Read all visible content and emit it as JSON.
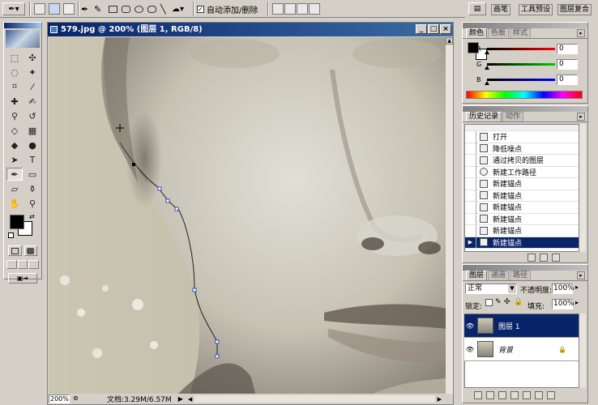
{
  "options_bar": {
    "auto_add_delete_label": "自动添加/删除",
    "auto_add_delete_checked": true
  },
  "panel_well": {
    "tabs": [
      "画笔",
      "工具预设",
      "图层复合"
    ]
  },
  "document": {
    "title": "579.jpg @ 200% (图层 1, RGB/8)",
    "zoom": "200%",
    "doc_size": "文档:3.29M/6.57M"
  },
  "color_panel": {
    "tabs": [
      "颜色",
      "色板",
      "样式"
    ],
    "active_tab": "颜色",
    "channels": [
      {
        "label": "R",
        "value": "0",
        "color": "#d00000"
      },
      {
        "label": "G",
        "value": "0",
        "color": "#00b000"
      },
      {
        "label": "B",
        "value": "0",
        "color": "#0000d0"
      }
    ],
    "foreground": "#000000",
    "background": "#ffffff"
  },
  "history_panel": {
    "tabs": [
      "历史记录",
      "动作"
    ],
    "active_tab": "历史记录",
    "items": [
      {
        "label": "打开"
      },
      {
        "label": "降低噪点"
      },
      {
        "label": "通过拷贝的图层"
      },
      {
        "label": "新建工作路径"
      },
      {
        "label": "新建锚点"
      },
      {
        "label": "新建锚点"
      },
      {
        "label": "新建锚点"
      },
      {
        "label": "新建锚点"
      },
      {
        "label": "新建锚点"
      },
      {
        "label": "新建锚点"
      }
    ],
    "selected_index": 9
  },
  "layers_panel": {
    "tabs": [
      "图层",
      "通道",
      "路径"
    ],
    "active_tab": "图层",
    "blend_mode": "正常",
    "opacity_label": "不透明度:",
    "opacity_value": "100%",
    "lock_label": "锁定:",
    "fill_label": "填充:",
    "fill_value": "100%",
    "layers": [
      {
        "name": "图层 1",
        "selected": true,
        "locked": false
      },
      {
        "name": "背景",
        "selected": false,
        "locked": true
      }
    ]
  }
}
